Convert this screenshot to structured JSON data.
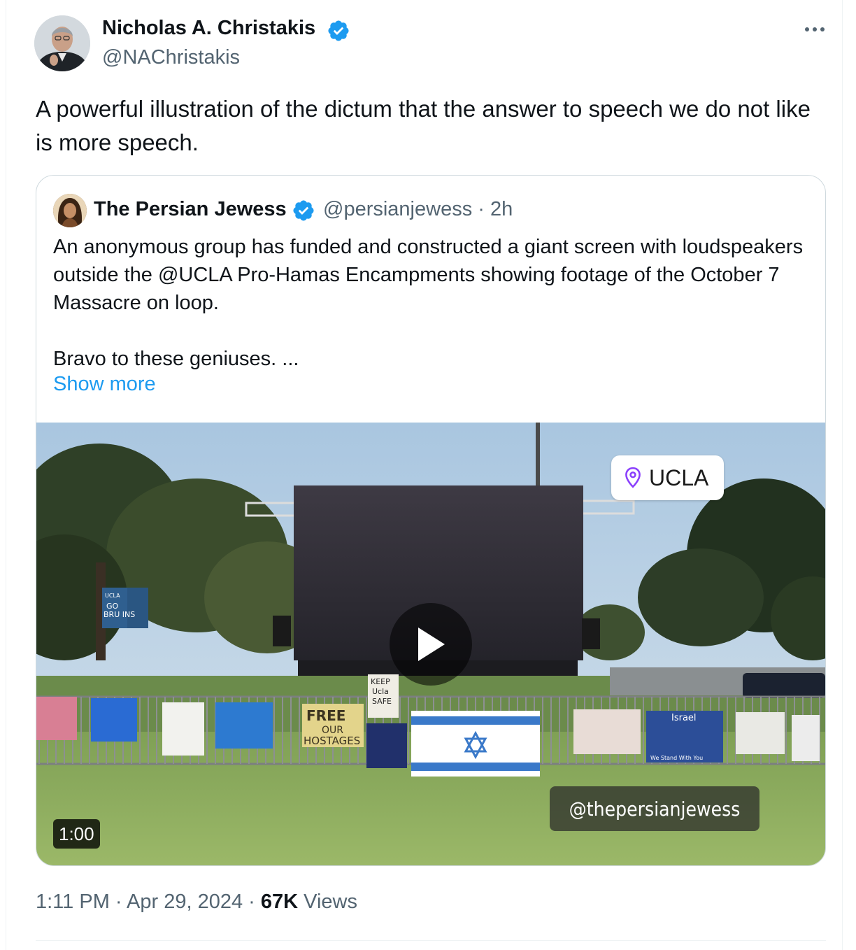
{
  "tweet": {
    "author": {
      "name": "Nicholas A. Christakis",
      "handle": "@NAChristakis"
    },
    "text": "A powerful illustration of the dictum that the answer to speech we do not like is more speech.",
    "quoted": {
      "author": {
        "name": "The Persian Jewess",
        "handle": "@persianjewess",
        "time": "2h"
      },
      "text_paragraph_1": "An anonymous group has funded and constructed a giant screen with loudspeakers outside the @UCLA Pro-Hamas Encampments showing footage of the October 7 Massacre on loop.",
      "text_paragraph_2": "Bravo to these geniuses. ...",
      "show_more": "Show more",
      "video": {
        "location_label": "UCLA",
        "watermark": "@thepersianjewess",
        "duration": "1:00",
        "signs": {
          "free_our_hostages": [
            "FREE",
            "OUR",
            "HOSTAGES"
          ],
          "keep_ucla_safe": [
            "KEEP",
            "Ucla",
            "SAFE"
          ],
          "go_bruins": [
            "UCLA",
            "GO",
            "BRU INS"
          ],
          "israel": "Israel",
          "we_stand_with_you": "We Stand With You"
        }
      }
    },
    "meta": {
      "time": "1:11 PM",
      "date": "Apr 29, 2024",
      "views_count": "67K",
      "views_label": "Views"
    }
  },
  "colors": {
    "text_primary": "#0f1419",
    "text_secondary": "#536471",
    "link": "#1d9bf0",
    "verified": "#1d9bf0",
    "border": "#cfd9de"
  },
  "icons": {
    "verified": "verified-badge-icon",
    "more": "more-options-icon",
    "play": "play-icon",
    "location": "location-pin-icon"
  }
}
